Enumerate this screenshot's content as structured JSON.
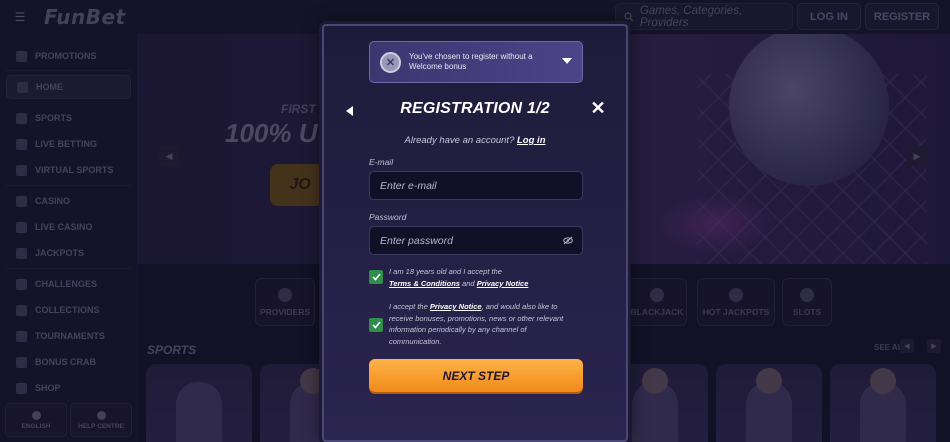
{
  "topbar": {
    "logo": "FunBet",
    "search_placeholder": "Games, Categories, Providers",
    "login_label": "LOG IN",
    "register_label": "REGISTER"
  },
  "sidebar": {
    "items": [
      {
        "label": "PROMOTIONS",
        "icon": "gift-icon"
      },
      {
        "label": "HOME",
        "icon": "home-icon"
      },
      {
        "label": "SPORTS",
        "icon": "ball-icon"
      },
      {
        "label": "LIVE BETTING",
        "icon": "live-icon"
      },
      {
        "label": "VIRTUAL SPORTS",
        "icon": "gamepad-icon"
      },
      {
        "label": "CASINO",
        "icon": "casino-icon"
      },
      {
        "label": "LIVE CASINO",
        "icon": "live-casino-icon"
      },
      {
        "label": "JACKPOTS",
        "icon": "jackpot-icon"
      },
      {
        "label": "CHALLENGES",
        "icon": "challenge-icon"
      },
      {
        "label": "COLLECTIONS",
        "icon": "collection-icon"
      },
      {
        "label": "TOURNAMENTS",
        "icon": "trophy-icon"
      },
      {
        "label": "BONUS CRAB",
        "icon": "crab-icon"
      },
      {
        "label": "SHOP",
        "icon": "shop-icon"
      }
    ],
    "language_label": "ENGLISH",
    "help_label": "HELP CENTRE"
  },
  "hero": {
    "subtitle": "FIRST D",
    "headline": "100% U",
    "join_label": "JO"
  },
  "categories": [
    "PROVIDERS",
    "BLACKJACK",
    "HOT JACKPOTS",
    "SLOTS"
  ],
  "sports": {
    "title": "SPORTS",
    "see_all": "SEE ALL"
  },
  "modal": {
    "bonus_text": "You've chosen to register without a Welcome bonus",
    "title": "REGISTRATION 1/2",
    "have_account": "Already have an account?",
    "login_link": "Log in",
    "email_label": "E-mail",
    "email_placeholder": "Enter e-mail",
    "password_label": "Password",
    "password_placeholder": "Enter password",
    "age_text_1": "I am 18 years old and I accept the",
    "terms_link": "Terms & Conditions",
    "and_text": "and",
    "privacy_link": "Privacy Notice",
    "marketing_text_1": "I accept the",
    "marketing_privacy_link": "Privacy Notice",
    "marketing_text_2": ", and would also like to receive bonuses, promotions, news or other relevant information periodically by any channel of communication.",
    "next_label": "NEXT STEP"
  },
  "colors": {
    "accent": "#f08a1c",
    "checkbox": "#2f8e4c",
    "modal_bg": "#231f42"
  }
}
